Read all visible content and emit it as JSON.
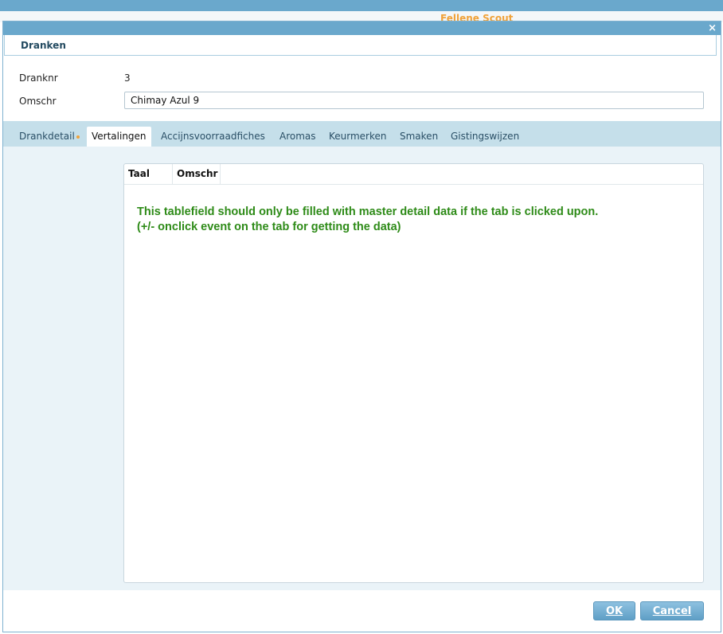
{
  "background": {
    "brand_text": "Fellene Scout"
  },
  "dialog": {
    "close_glyph": "×",
    "panel_title": "Dranken",
    "fields": {
      "dranknr_label": "Dranknr",
      "dranknr_value": "3",
      "omschr_label": "Omschr",
      "omschr_value": "Chimay Azul 9"
    },
    "tabs": [
      {
        "label": "Drankdetail",
        "active": false,
        "modified_dot": true
      },
      {
        "label": "Vertalingen",
        "active": true,
        "modified_dot": false
      },
      {
        "label": "Accijnsvoorraadfiches",
        "active": false,
        "modified_dot": false
      },
      {
        "label": "Aromas",
        "active": false,
        "modified_dot": false
      },
      {
        "label": "Keurmerken",
        "active": false,
        "modified_dot": false
      },
      {
        "label": "Smaken",
        "active": false,
        "modified_dot": false
      },
      {
        "label": "Gistingswijzen",
        "active": false,
        "modified_dot": false
      }
    ],
    "table": {
      "columns": [
        "Taal",
        "Omschr"
      ],
      "notice_line1": "This tablefield should only be filled with master detail data if the tab is clicked upon.",
      "notice_line2": "(+/- onclick event on the tab for getting the data)"
    },
    "buttons": {
      "ok_label": "OK",
      "cancel_label": "Cancel"
    }
  },
  "colors": {
    "titlebar": "#6aa8cc",
    "tabbar": "#c5dfea",
    "notice_text": "#2e8b18",
    "accent_dot": "#f0a23a"
  }
}
